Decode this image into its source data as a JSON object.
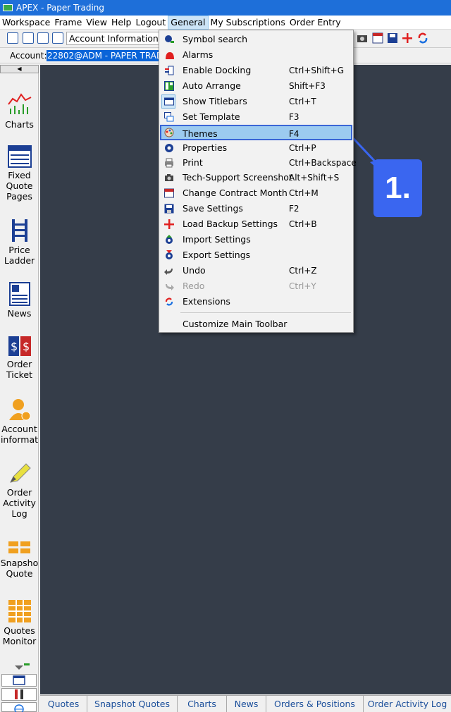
{
  "window": {
    "title": "APEX - Paper Trading"
  },
  "menubar": {
    "items": [
      "Workspace",
      "Frame",
      "View",
      "Help",
      "Logout",
      "General",
      "My Subscriptions",
      "Order Entry"
    ],
    "active": "General"
  },
  "toolbar": {
    "account_info_label": "Account Information"
  },
  "account_bar": {
    "label": "Account:",
    "value": "22802@ADM - PAPER TRADING"
  },
  "sidebar": {
    "items": [
      {
        "label": "Charts",
        "icon": "charts-icon"
      },
      {
        "label": "Fixed Quote Pages",
        "icon": "fixed-quote-pages-icon"
      },
      {
        "label": "Price Ladder",
        "icon": "price-ladder-icon"
      },
      {
        "label": "News",
        "icon": "news-icon"
      },
      {
        "label": "Order Ticket",
        "icon": "order-ticket-icon"
      },
      {
        "label": "Account informat",
        "icon": "account-information-icon"
      },
      {
        "label": "Order Activity Log",
        "icon": "order-activity-log-icon"
      },
      {
        "label": "Snapsho Quote",
        "icon": "snapshot-quote-icon"
      },
      {
        "label": "Quotes Monitor",
        "icon": "quotes-monitor-icon"
      }
    ]
  },
  "general_menu": {
    "items": [
      {
        "label": "Symbol search",
        "shortcut": "",
        "icon": "symbol-search-icon"
      },
      {
        "label": "Alarms",
        "shortcut": "",
        "icon": "alarm-icon"
      },
      {
        "label": "Enable Docking",
        "shortcut": "Ctrl+Shift+G",
        "icon": "docking-icon"
      },
      {
        "label": "Auto Arrange",
        "shortcut": "Shift+F3",
        "icon": "auto-arrange-icon"
      },
      {
        "label": "Show Titlebars",
        "shortcut": "Ctrl+T",
        "icon": "titlebar-icon"
      },
      {
        "label": "Set Template",
        "shortcut": "F3",
        "icon": "template-icon"
      },
      {
        "label": "Themes",
        "shortcut": "F4",
        "icon": "themes-icon"
      },
      {
        "label": "Properties",
        "shortcut": "Ctrl+P",
        "icon": "properties-icon"
      },
      {
        "label": "Print",
        "shortcut": "Ctrl+Backspace",
        "icon": "print-icon"
      },
      {
        "label": "Tech-Support Screenshot",
        "shortcut": "Alt+Shift+S",
        "icon": "camera-icon"
      },
      {
        "label": "Change Contract Month",
        "shortcut": "Ctrl+M",
        "icon": "calendar-icon"
      },
      {
        "label": "Save Settings",
        "shortcut": "F2",
        "icon": "save-icon"
      },
      {
        "label": "Load Backup Settings",
        "shortcut": "Ctrl+B",
        "icon": "plus-icon"
      },
      {
        "label": "Import Settings",
        "shortcut": "",
        "icon": "import-settings-icon"
      },
      {
        "label": "Export Settings",
        "shortcut": "",
        "icon": "export-settings-icon"
      },
      {
        "label": "Undo",
        "shortcut": "Ctrl+Z",
        "icon": "undo-icon"
      },
      {
        "label": "Redo",
        "shortcut": "Ctrl+Y",
        "icon": "redo-icon"
      },
      {
        "label": "Extensions",
        "shortcut": "",
        "icon": "extensions-icon"
      },
      {
        "label": "Customize Main Toolbar",
        "shortcut": "",
        "icon": ""
      }
    ],
    "highlighted": "Themes"
  },
  "callout": {
    "label": "1.",
    "color": "#3a66f0"
  },
  "bottom_tabs": [
    "Quotes",
    "Snapshot Quotes",
    "Charts",
    "News",
    "Orders & Positions",
    "Order Activity Log"
  ],
  "colors": {
    "workspace_bg": "#353d49",
    "titlebar": "#1e6fd9",
    "highlight": "#9ccbf0",
    "highlight_border": "#3a66d6"
  }
}
